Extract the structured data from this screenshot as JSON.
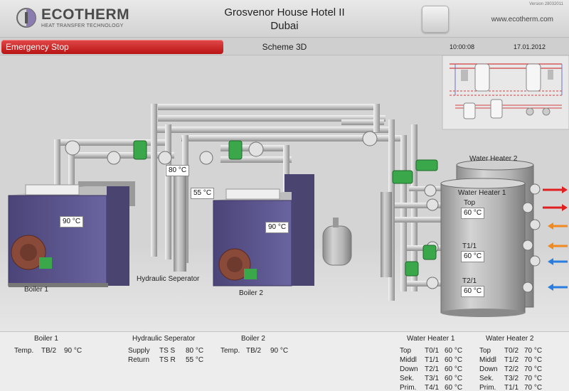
{
  "header": {
    "brand": "ECOTHERM",
    "brand_sub": "HEAT TRANSFER TECHNOLOGY",
    "title_line1": "Grosvenor House Hotel II",
    "title_line2": "Dubai",
    "version": "Version 28032011",
    "website": "www.ecotherm.com"
  },
  "statusbar": {
    "emergency_stop": "Emergency Stop",
    "scheme": "Scheme 3D",
    "time": "10:00:08",
    "date": "17.01.2012"
  },
  "scheme": {
    "boiler1": {
      "label": "Boiler 1",
      "temp": "90 °C"
    },
    "boiler2": {
      "label": "Boiler 2",
      "temp": "90 °C"
    },
    "hydraulic": {
      "label": "Hydraulic Seperator",
      "temp_top": "80 °C",
      "temp_mid": "55 °C"
    },
    "heater1": {
      "label": "Water Heater 1",
      "top_label": "Top",
      "top_temp": "60 °C",
      "t11_label": "T1/1",
      "t11_temp": "60 °C",
      "t21_label": "T2/1",
      "t21_temp": "60 °C"
    },
    "heater2": {
      "label": "Water Heater 2"
    }
  },
  "info": {
    "boiler1": {
      "title": "Boiler 1",
      "row": [
        "Temp.",
        "TB/2",
        "90 °C"
      ]
    },
    "hydraulic": {
      "title": "Hydraulic Seperator",
      "supply": [
        "Supply",
        "TS S",
        "80 °C"
      ],
      "return": [
        "Return",
        "TS R",
        "55 °C"
      ]
    },
    "boiler2": {
      "title": "Boiler 2",
      "row": [
        "Temp.",
        "TB/2",
        "90 °C"
      ]
    },
    "heater1": {
      "title": "Water Heater 1",
      "rows": [
        [
          "Top",
          "T0/1",
          "60 °C"
        ],
        [
          "Middl",
          "T1/1",
          "60 °C"
        ],
        [
          "Down",
          "T2/1",
          "60 °C"
        ],
        [
          "Sek.",
          "T3/1",
          "60 °C"
        ],
        [
          "Prim.",
          "T4/1",
          "60 °C"
        ]
      ]
    },
    "heater2": {
      "title": "Water Heater 2",
      "rows": [
        [
          "Top",
          "T0/2",
          "70 °C"
        ],
        [
          "Middl",
          "T1/2",
          "70 °C"
        ],
        [
          "Down",
          "T2/2",
          "70 °C"
        ],
        [
          "Sek.",
          "T3/2",
          "70 °C"
        ],
        [
          "Prim.",
          "T1/1",
          "70 °C"
        ]
      ]
    }
  },
  "colors": {
    "estop": "#c82020",
    "boiler": "#5a5488",
    "burner": "#8a4a3a",
    "valve_green": "#3aa84a",
    "pipe": "#bdbdbd",
    "arrow_hot": "#e02020",
    "arrow_warm": "#f08a20",
    "arrow_cold": "#2a7de0"
  }
}
